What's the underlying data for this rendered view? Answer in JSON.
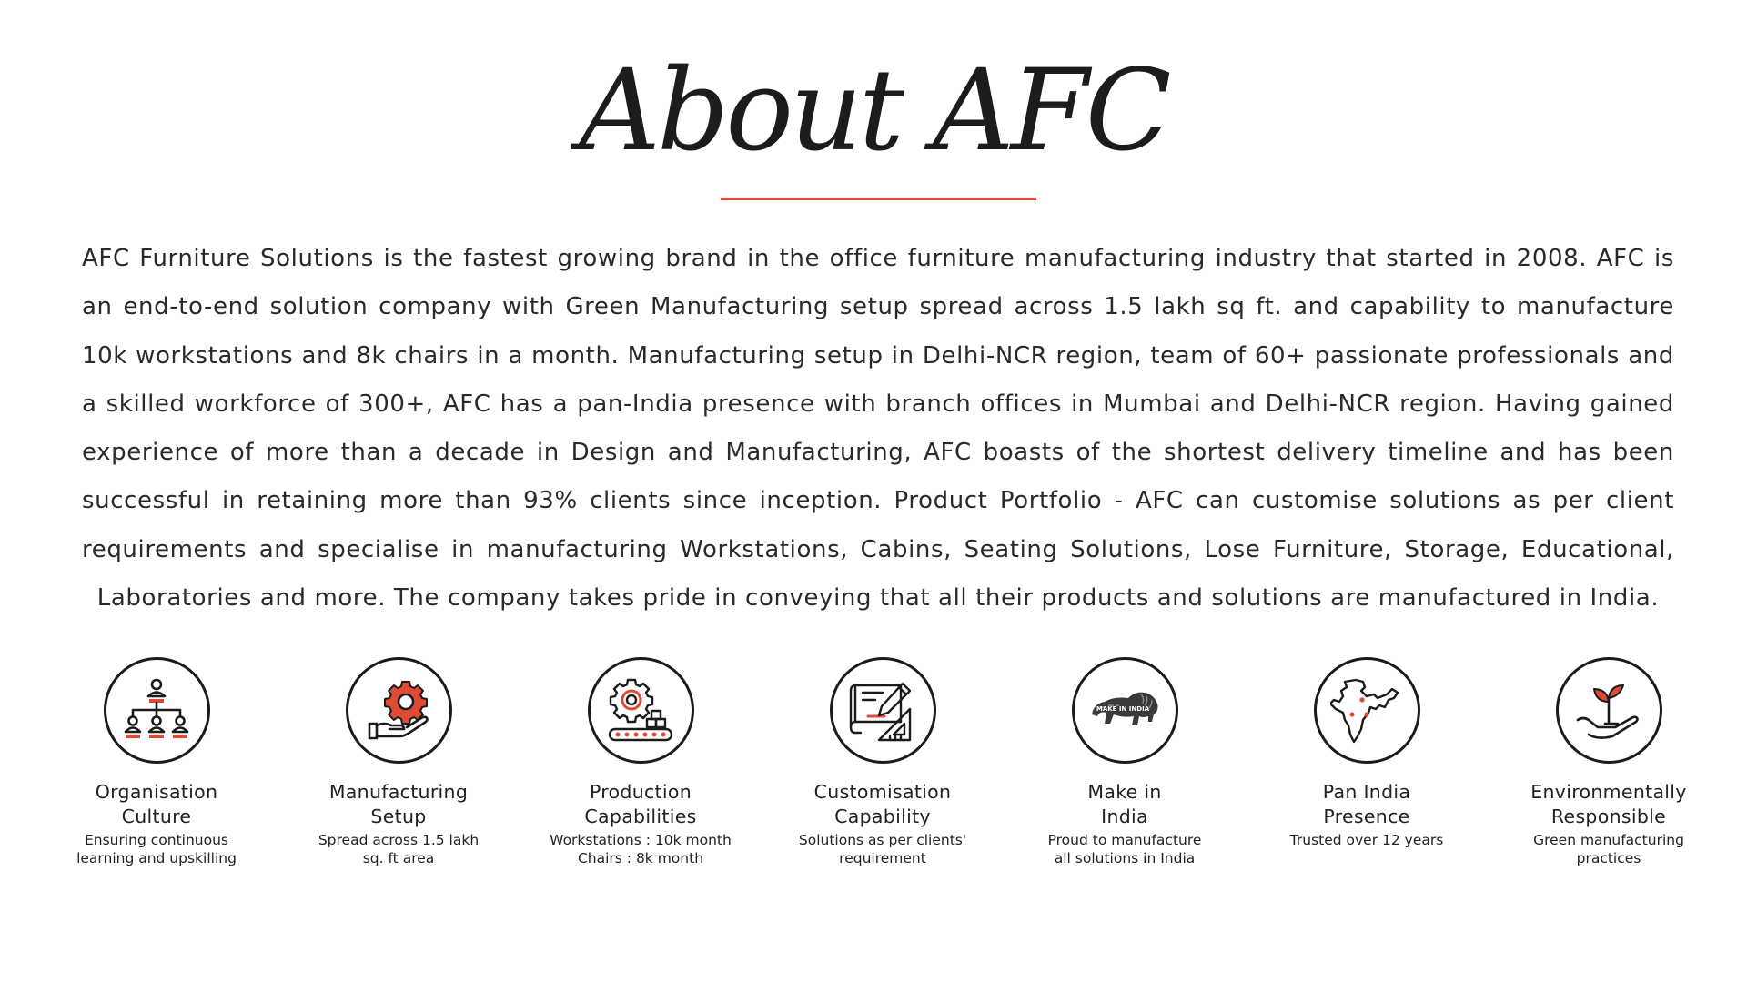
{
  "title": "About AFC",
  "description": "AFC Furniture Solutions is the fastest growing brand in the office furniture manufacturing industry that started in 2008. AFC is an end-to-end solution company with Green Manufacturing setup spread across 1.5 lakh sq ft. and capability to manufacture 10k workstations and 8k chairs in a month. Manufacturing setup in Delhi-NCR region, team of 60+ passionate professionals and a skilled workforce of 300+, AFC has a pan-India presence with branch offices in Mumbai and Delhi-NCR region. Having gained experience of more than a decade in Design and Manufacturing, AFC boasts of the shortest delivery timeline and has been successful in retaining more than 93% clients since inception. Product Portfolio - AFC can customise solutions as per client requirements and specialise in manufacturing Workstations, Cabins, Seating Solutions, Lose Furniture, Storage, Educational, Laboratories and more. The company takes pride in conveying that all their products and solutions are manufactured in India.",
  "accent_color": "#e04a35",
  "features": [
    {
      "icon": "organisation-icon",
      "title": "Organisation\nCulture",
      "desc": "Ensuring continuous\nlearning and upskilling"
    },
    {
      "icon": "gear-hand-icon",
      "title": "Manufacturing\nSetup",
      "desc": "Spread across 1.5 lakh\nsq. ft area"
    },
    {
      "icon": "production-gear-icon",
      "title": "Production\nCapabilities",
      "desc": "Workstations : 10k month\nChairs : 8k month"
    },
    {
      "icon": "design-pencil-icon",
      "title": "Customisation\nCapability",
      "desc": "Solutions as per clients'\nrequirement"
    },
    {
      "icon": "make-in-india-lion-icon",
      "title": "Make in\nIndia",
      "desc": "Proud to manufacture\nall solutions in India",
      "logo_text": "MAKE IN INDIA"
    },
    {
      "icon": "india-map-icon",
      "title": "Pan India\nPresence",
      "desc": "Trusted over 12 years"
    },
    {
      "icon": "plant-hand-icon",
      "title": "Environmentally\nResponsible",
      "desc": "Green manufacturing\npractices"
    }
  ]
}
